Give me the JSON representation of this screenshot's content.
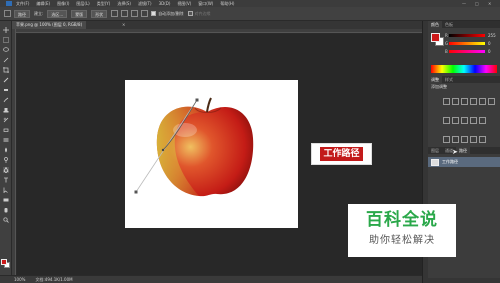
{
  "menubar": {
    "items": [
      "文件(F)",
      "编辑(E)",
      "图像(I)",
      "图层(L)",
      "类型(Y)",
      "选择(S)",
      "滤镜(T)",
      "3D(D)",
      "视图(V)",
      "窗口(W)",
      "帮助(H)"
    ],
    "window_controls": [
      "—",
      "□",
      "✕"
    ]
  },
  "options_bar": {
    "mode": "路径",
    "make_label": "建立:",
    "selection_button": "选区...",
    "mask_button": "蒙版",
    "shape_button": "形状",
    "auto_add_delete": "自动添加/删除",
    "align_edges": "对齐边缘"
  },
  "document_tab": {
    "title": "苹果.png @ 100% (图层 0, RGB/8)",
    "close": "×"
  },
  "annotation": {
    "label": "工作路径"
  },
  "status_bar": {
    "zoom": "100%",
    "doc_size": "文档:494.1K/1.00M"
  },
  "panels": {
    "color_tabs": [
      "颜色",
      "色板"
    ],
    "color": {
      "foreground": "#cc1a1a",
      "background": "#ffffff",
      "sliders": [
        {
          "label": "R",
          "value": "255"
        },
        {
          "label": "G",
          "value": "0"
        },
        {
          "label": "B",
          "value": "0"
        }
      ]
    },
    "adjust_tabs": [
      "调整",
      "样式"
    ],
    "adjust_title": "添加调整",
    "layer_tabs": [
      "图层",
      "通道",
      "路径"
    ],
    "paths": [
      {
        "name": "工作路径"
      }
    ]
  },
  "watermark": {
    "title": "百科全说",
    "subtitle": "助你轻松解决"
  },
  "colors": {
    "accent_red": "#c21a1a",
    "watermark_green": "#2aa84a",
    "ui_dark": "#2b2b2b"
  }
}
